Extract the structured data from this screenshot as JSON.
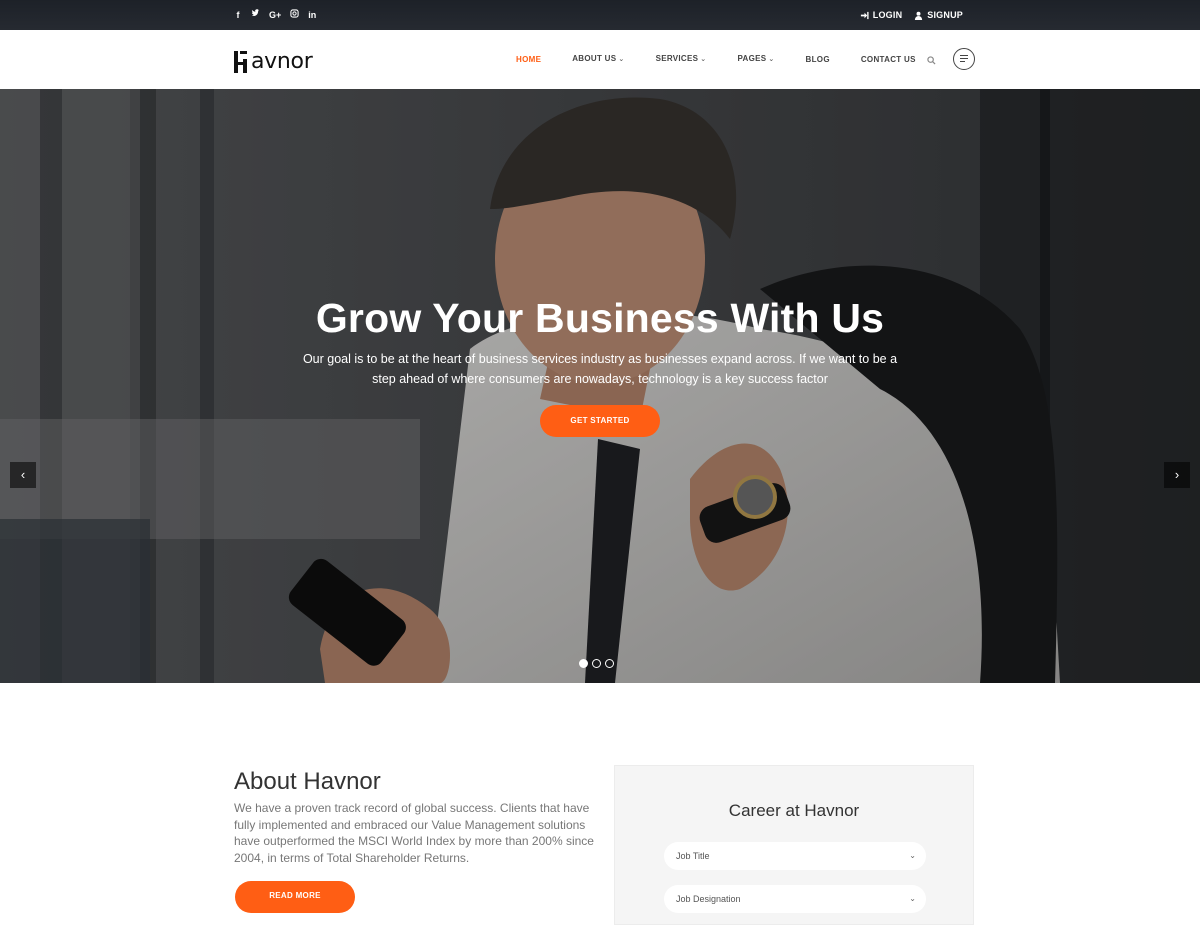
{
  "topbar": {
    "social": [
      {
        "icon": "facebook-icon",
        "glyph": "f"
      },
      {
        "icon": "twitter-icon",
        "glyph": "ⓣ"
      },
      {
        "icon": "google-plus-icon",
        "glyph": "G+"
      },
      {
        "icon": "instagram-icon",
        "glyph": "◎"
      },
      {
        "icon": "linkedin-icon",
        "glyph": "in"
      }
    ],
    "login_label": "LOGIN",
    "signup_label": "SIGNUP"
  },
  "header": {
    "logo_text": "avnor",
    "nav": [
      {
        "label": "HOME",
        "dropdown": false,
        "active": true
      },
      {
        "label": "ABOUT US",
        "dropdown": true,
        "active": false
      },
      {
        "label": "SERVICES",
        "dropdown": true,
        "active": false
      },
      {
        "label": "PAGES",
        "dropdown": true,
        "active": false
      },
      {
        "label": "BLOG",
        "dropdown": false,
        "active": false
      },
      {
        "label": "CONTACT US",
        "dropdown": false,
        "active": false
      }
    ]
  },
  "hero": {
    "title": "Grow Your Business With Us",
    "description": "Our goal is to be at the heart of business services industry as businesses expand across. If we want to be a step ahead of where consumers are nowadays, technology is a key success factor",
    "cta_label": "GET STARTED",
    "slides_total": 3,
    "active_slide": 1
  },
  "about": {
    "title": "About Havnor",
    "text": "We have a proven track record of global success. Clients that have fully implemented and embraced our Value Management solutions have outperformed the MSCI World Index by more than 200% since 2004, in terms of Total Shareholder Returns.",
    "button_label": "READ MORE"
  },
  "career": {
    "title": "Career at Havnor",
    "fields": [
      {
        "label": "Job Title"
      },
      {
        "label": "Job Designation"
      }
    ]
  },
  "colors": {
    "accent": "#ff5e14",
    "topbar": "#1d2128"
  }
}
